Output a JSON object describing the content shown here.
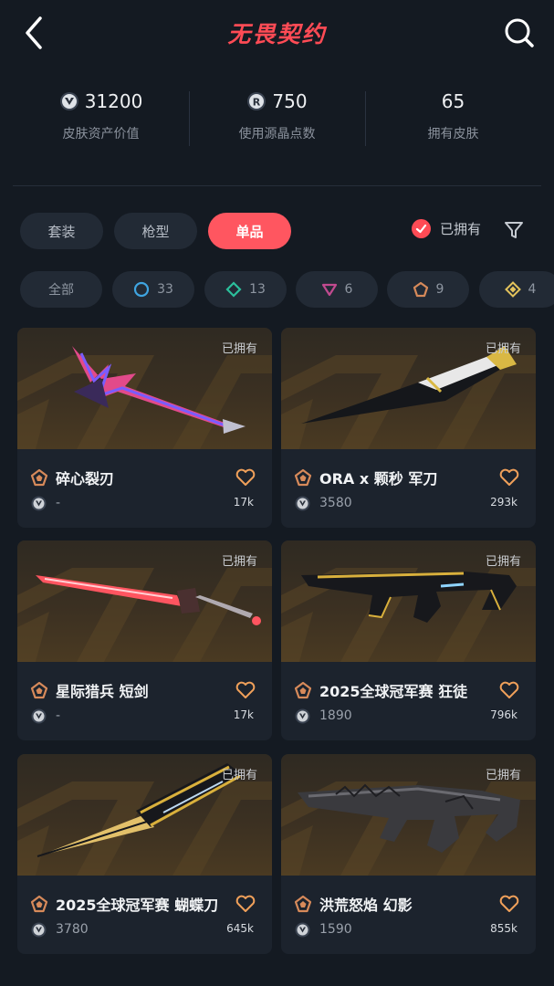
{
  "header": {
    "title": "无畏契约",
    "back_icon": "chevron-left-icon",
    "search_icon": "search-icon"
  },
  "stats": [
    {
      "value": "31200",
      "label": "皮肤资产价值",
      "icon": "vp-coin-icon"
    },
    {
      "value": "750",
      "label": "使用源晶点数",
      "icon": "radianite-icon"
    },
    {
      "value": "65",
      "label": "拥有皮肤",
      "icon": ""
    }
  ],
  "tabs": [
    {
      "label": "套装",
      "active": false
    },
    {
      "label": "枪型",
      "active": false
    },
    {
      "label": "单品",
      "active": true
    }
  ],
  "owned_filter": {
    "label": "已拥有",
    "checked": true
  },
  "rarity_chips": [
    {
      "label": "全部",
      "icon": ""
    },
    {
      "label": "33",
      "icon": "select-tier-icon",
      "color": "#3fa4e0"
    },
    {
      "label": "13",
      "icon": "deluxe-tier-icon",
      "color": "#2bbf9b"
    },
    {
      "label": "6",
      "icon": "premium-tier-icon",
      "color": "#c14a8f"
    },
    {
      "label": "9",
      "icon": "exclusive-tier-icon",
      "color": "#d78a5a"
    },
    {
      "label": "4",
      "icon": "ultra-tier-icon",
      "color": "#e3c35c"
    }
  ],
  "colors": {
    "accent": "#ff5660",
    "background": "#141a22",
    "card": "#1c232d",
    "heart": "#f0a05a",
    "badge": "#d78a5a"
  },
  "cards": [
    {
      "owned_tag": "已拥有",
      "name": "碎心裂刃",
      "price": "-",
      "likes": "17k",
      "weapon": "pink-sword-icon"
    },
    {
      "owned_tag": "已拥有",
      "name": "ORA x 颗秒 军刀",
      "price": "3580",
      "likes": "293k",
      "weapon": "black-blade-icon"
    },
    {
      "owned_tag": "已拥有",
      "name": "星际猎兵 短剑",
      "price": "-",
      "likes": "17k",
      "weapon": "red-shortsword-icon"
    },
    {
      "owned_tag": "已拥有",
      "name": "2025全球冠军赛 狂徒",
      "price": "1890",
      "likes": "796k",
      "weapon": "gold-rifle-icon"
    },
    {
      "owned_tag": "已拥有",
      "name": "2025全球冠军赛 蝴蝶刀",
      "price": "3780",
      "likes": "645k",
      "weapon": "butterfly-knife-icon"
    },
    {
      "owned_tag": "已拥有",
      "name": "洪荒怒焰 幻影",
      "price": "1590",
      "likes": "855k",
      "weapon": "dragon-rifle-icon"
    }
  ]
}
